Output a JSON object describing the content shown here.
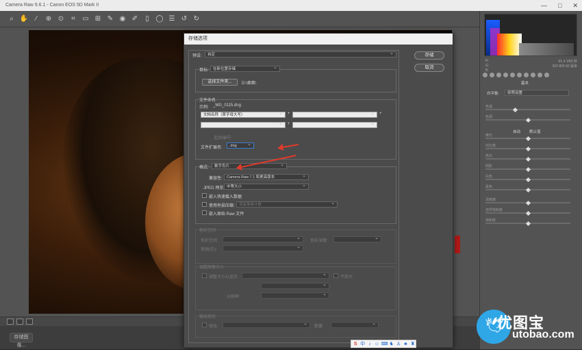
{
  "window": {
    "title": "Camera Raw 9.6.1 - Canon EOS 5D Mark II",
    "controls": [
      "—",
      "□",
      "✕"
    ]
  },
  "toolbar": {
    "icons": [
      "zoom-icon",
      "hand-icon",
      "white-balance-icon",
      "color-sampler-icon",
      "target-adjust-icon",
      "crop-icon",
      "straighten-icon",
      "transform-icon",
      "spot-removal-icon",
      "red-eye-icon",
      "adjust-brush-icon",
      "graduated-filter-icon",
      "radial-filter-icon",
      "preferences-icon",
      "rotate-ccw-icon",
      "rotate-cw-icon"
    ],
    "glyphs": [
      "⌕",
      "✋",
      "⁄",
      "⊕",
      "⊙",
      "⌗",
      "▭",
      "⊞",
      "✎",
      "◉",
      "✐",
      "▯",
      "◯",
      "☰",
      "↺",
      "↻"
    ]
  },
  "footer": {
    "save_label": "存储图像..."
  },
  "histogram": {
    "info_left": [
      "R:",
      "G:",
      "B:"
    ],
    "info_right": [
      "f/1.4   1/80 秒",
      "ISO 800   50 毫米"
    ]
  },
  "right_panel": {
    "header": "基本",
    "white_balance_label": "白平衡:",
    "white_balance_value": "原照设置",
    "auto_label": "自动",
    "default_label": "默认值",
    "sliders": [
      {
        "label": "色温",
        "pos": 0.35
      },
      {
        "label": "色调",
        "pos": 0.5
      },
      {
        "label": "曝光",
        "pos": 0.5
      },
      {
        "label": "对比度",
        "pos": 0.5
      },
      {
        "label": "高光",
        "pos": 0.5
      },
      {
        "label": "阴影",
        "pos": 0.5
      },
      {
        "label": "白色",
        "pos": 0.5
      },
      {
        "label": "黑色",
        "pos": 0.5
      },
      {
        "label": "清晰度",
        "pos": 0.5
      },
      {
        "label": "自然饱和度",
        "pos": 0.5
      },
      {
        "label": "饱和度",
        "pos": 0.5
      }
    ]
  },
  "dialog": {
    "title": "存储选项",
    "preset_label": "预设:",
    "preset_value": "自定",
    "save_button": "存储",
    "cancel_button": "取消",
    "dest": {
      "label": "目标:",
      "value": "在新位置存储",
      "folder_button": "选择文件夹...",
      "path": "D:\\桌面\\"
    },
    "naming": {
      "section": "文件命名",
      "example_label": "示例:",
      "example_value": "_MG_0115.dng",
      "field1": "文档名称（首字母大写）",
      "field2": "",
      "field3": "",
      "field4": "",
      "plus": "+",
      "start_number_label": "起始编号:",
      "ext_label": "文件扩展名:",
      "ext_value": ".dng"
    },
    "format": {
      "label": "格式:",
      "value": "数字负片",
      "compat_label": "兼容性:",
      "compat_value": "Camera Raw 7.1 和更高版本",
      "jpeg_label": "JPEG 预览:",
      "jpeg_value": "中等大小",
      "embed_fast": "嵌入快速载入数据",
      "lossy": "使用有损压缩:",
      "lossy_value": "保留像素计数",
      "embed_raw": "嵌入原始 Raw 文件"
    },
    "color": {
      "section": "色彩空间",
      "space_label": "色彩空间:",
      "intent_label": "色彩深度:",
      "depth_label": "意图(位):"
    },
    "resize": {
      "section": "调整图像大小",
      "fit_label": "调整大小以适合",
      "no_enlarge": "不放大",
      "res_label": "分辨率:"
    },
    "sharpen": {
      "section": "输出锐化",
      "for_label": "锐化:",
      "amount_label": "数量:"
    }
  },
  "taskbar": {
    "items": [
      "S",
      "中",
      "♪",
      "☺",
      "⌨",
      "♞",
      "♙",
      "♣",
      "♜"
    ]
  },
  "watermark": {
    "cn": "优图宝",
    "en": "utobao.com",
    "p": "PS"
  }
}
